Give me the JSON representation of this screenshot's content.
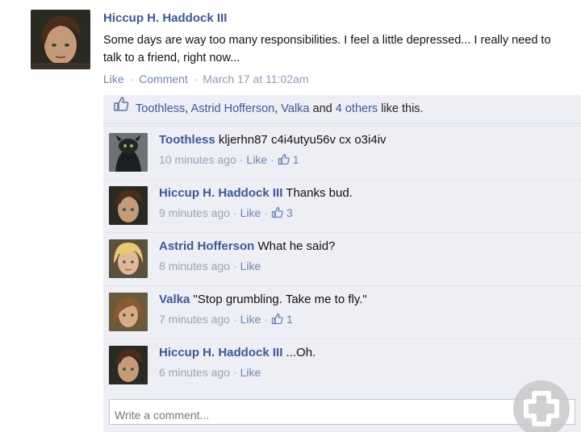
{
  "post": {
    "author": "Hiccup H. Haddock III",
    "text": "Some days are way too many responsibilities. I feel a little depressed... I really need to talk to a friend, right now...",
    "like_label": "Like",
    "comment_label": "Comment",
    "timestamp": "March 17 at 11:02am"
  },
  "likes": {
    "names": [
      "Toothless",
      "Astrid Hofferson",
      "Valka"
    ],
    "others": "4 others",
    "and": "and",
    "suffix": "like this."
  },
  "comments": [
    {
      "author": "Toothless",
      "text": "kljerhn87 c4i4utyu56v cx o3i4iv",
      "time": "10 minutes ago",
      "like_label": "Like",
      "like_count": "1"
    },
    {
      "author": "Hiccup H. Haddock III",
      "text": "Thanks bud.",
      "time": "9 minutes ago",
      "like_label": "Like",
      "like_count": "3"
    },
    {
      "author": "Astrid Hofferson",
      "text": "What he said?",
      "time": "8 minutes ago",
      "like_label": "Like",
      "like_count": ""
    },
    {
      "author": "Valka",
      "text": "\"Stop grumbling. Take me to fly.\"",
      "time": "7 minutes ago",
      "like_label": "Like",
      "like_count": "1"
    },
    {
      "author": "Hiccup H. Haddock III",
      "text": "...Oh.",
      "time": "6 minutes ago",
      "like_label": "Like",
      "like_count": ""
    }
  ],
  "write_comment": {
    "placeholder": "Write a comment..."
  },
  "colors": {
    "link": "#3b5998",
    "box": "#edeff4",
    "meta": "#9aa3b8"
  }
}
